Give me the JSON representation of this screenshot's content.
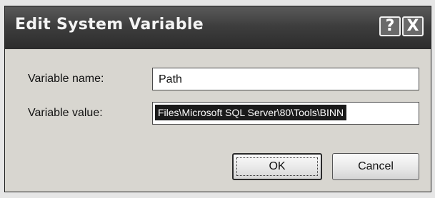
{
  "window": {
    "title": "Edit System Variable",
    "help_label": "?",
    "close_label": "X"
  },
  "form": {
    "name_label": "Variable name:",
    "name_value": "Path",
    "value_label": "Variable value:",
    "value_value": "Files\\Microsoft SQL Server\\80\\Tools\\BINN"
  },
  "buttons": {
    "ok_label": "OK",
    "cancel_label": "Cancel"
  }
}
